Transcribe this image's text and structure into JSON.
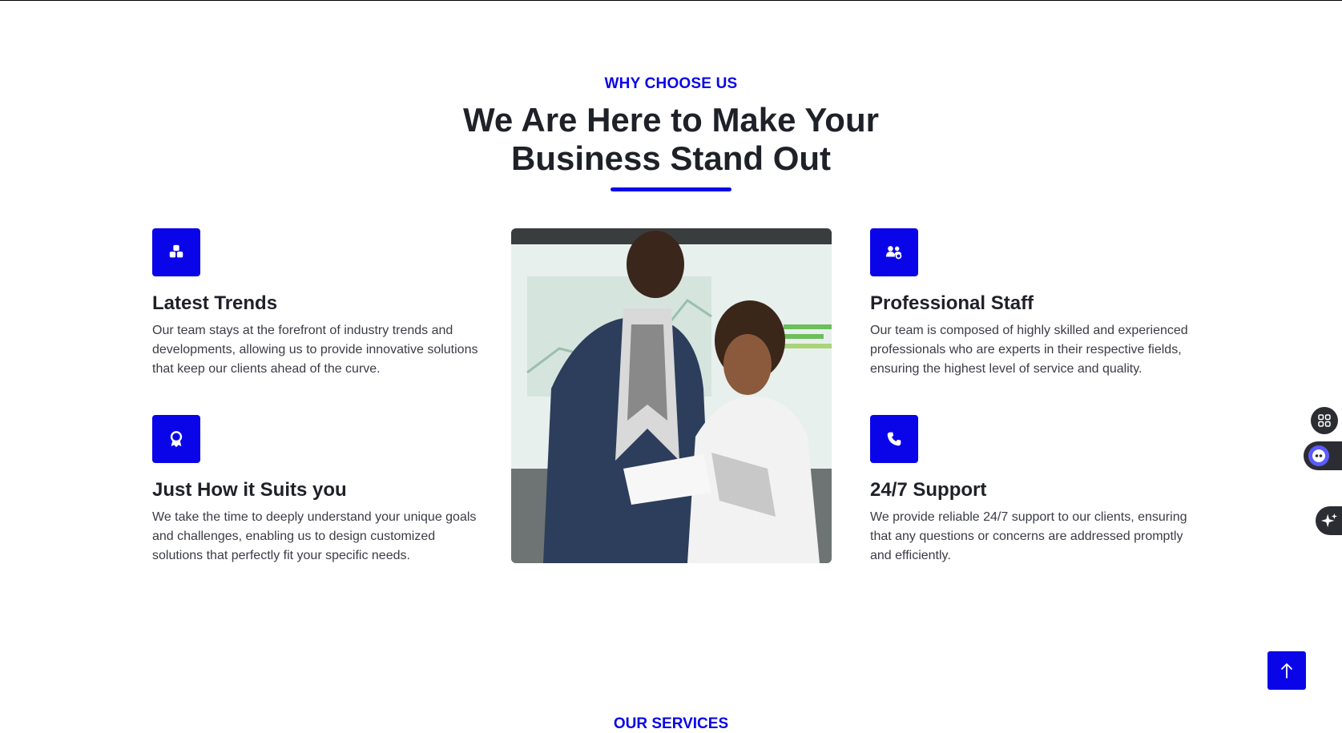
{
  "section": {
    "eyebrow": "WHY CHOOSE US",
    "headline": "We Are Here to Make Your Business Stand Out"
  },
  "features": [
    {
      "icon": "cubes-icon",
      "title": "Latest Trends",
      "text": "Our team stays at the forefront of industry trends and developments, allowing us to provide innovative solutions that keep our clients ahead of the curve."
    },
    {
      "icon": "award-icon",
      "title": "Just How it Suits you",
      "text": "We take the time to deeply understand your unique goals and challenges, enabling us to design customized solutions that perfectly fit your specific needs."
    },
    {
      "icon": "users-gear-icon",
      "title": "Professional Staff",
      "text": "Our team is composed of highly skilled and experienced professionals who are experts in their respective fields, ensuring the highest level of service and quality."
    },
    {
      "icon": "phone-icon",
      "title": "24/7 Support",
      "text": "We provide reliable 24/7 support to our clients, ensuring that any questions or concerns are addressed promptly and efficiently."
    }
  ],
  "next_section": {
    "eyebrow": "OUR SERVICES"
  },
  "colors": {
    "accent": "#0a05e8",
    "text": "#1f2128",
    "body_text": "#3b3d45",
    "float_dark": "#2b2d33"
  }
}
